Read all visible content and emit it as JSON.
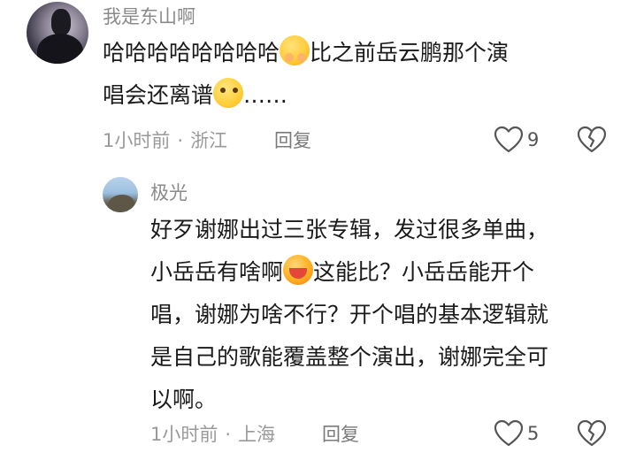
{
  "comments": [
    {
      "username": "我是东山啊",
      "lines": [
        "哈哈哈哈哈哈哈哈",
        "比之前岳云鹏那个演",
        "唱会还离谱",
        "……"
      ],
      "emojis": [
        "hug-emoji",
        "smirk-emoji"
      ],
      "time": "1小时前",
      "location": "浙江",
      "reply_label": "回复",
      "like_count": "9"
    },
    {
      "username": "极光",
      "lines": [
        "好歹谢娜出过三张专辑，发过很多单曲，",
        "小岳岳有啥啊",
        "这能比？小岳岳能开个",
        "唱，谢娜为啥不行？开个唱的基本逻辑就",
        "是自己的歌能覆盖整个演出，谢娜完全可",
        "以啊。"
      ],
      "emojis": [
        "laugh-emoji"
      ],
      "time": "1小时前",
      "location": "上海",
      "reply_label": "回复",
      "like_count": "5"
    }
  ],
  "meta_separator": "·",
  "colors": {
    "text": "#1a1a1a",
    "username": "#8a8a8a",
    "meta": "#9a9a9a"
  }
}
